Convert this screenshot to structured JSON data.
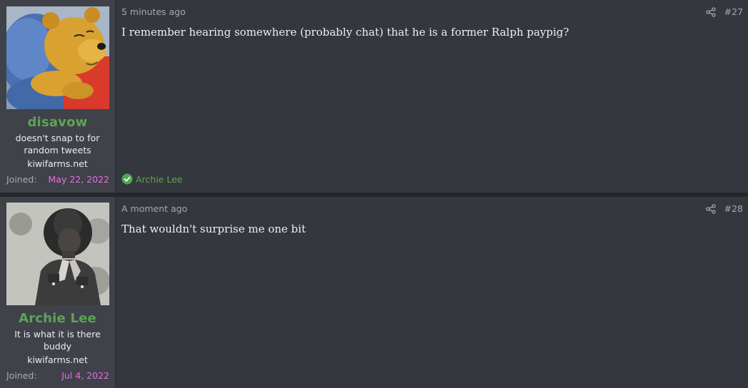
{
  "posts": [
    {
      "user": {
        "username": "disavow",
        "title": "doesn't snap to for random tweets",
        "site": "kiwifarms.net",
        "joined_label": "Joined:",
        "joined_date": "May 22, 2022",
        "avatar_icon": "winnie-the-pooh-avatar"
      },
      "timestamp": "5 minutes ago",
      "post_number": "#27",
      "body": "I remember hearing somewhere (probably chat) that he is a former Ralph paypig?",
      "reaction": {
        "icon": "checkmark-circle-icon",
        "label": "Archie Lee"
      }
    },
    {
      "user": {
        "username": "Archie Lee",
        "title": "It is what it is there buddy",
        "site": "kiwifarms.net",
        "joined_label": "Joined:",
        "joined_date": "Jul 4, 2022",
        "avatar_icon": "cowboy-photo-avatar"
      },
      "timestamp": "A moment ago",
      "post_number": "#28",
      "body": "That wouldn't surprise me one bit"
    }
  ],
  "colors": {
    "username": "#5ea356",
    "joined_date": "#e56ee0",
    "reaction": "#5ea356",
    "background": "#35373e",
    "user_panel": "#3f4249"
  }
}
